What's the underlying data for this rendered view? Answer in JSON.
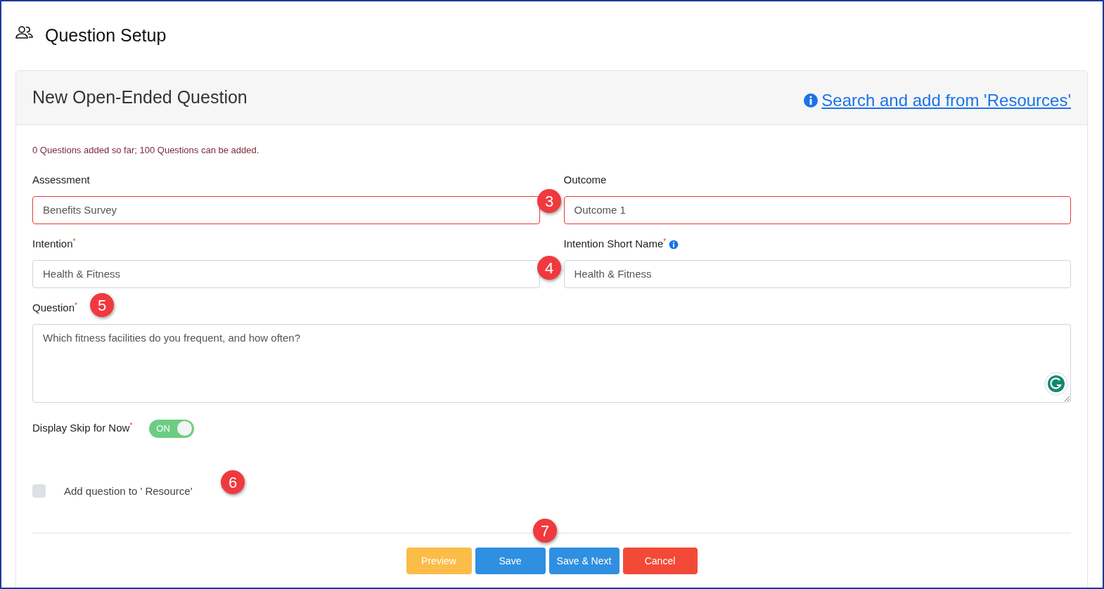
{
  "page": {
    "title": "Question Setup"
  },
  "card": {
    "title": "New Open-Ended Question",
    "resource_link": "Search and add from 'Resources'"
  },
  "count_note": "0 Questions added so far; 100 Questions can be added.",
  "fields": [
    {
      "kind": "input",
      "label": "Assessment",
      "value": "Benefits Survey",
      "error": true,
      "info": false
    },
    {
      "kind": "input",
      "label": "Outcome",
      "value": "Outcome 1",
      "error": true,
      "info": false
    },
    {
      "kind": "input",
      "label": "Intention",
      "required_mark": "*",
      "value": "Health & Fitness",
      "error": false,
      "info": false
    },
    {
      "kind": "input",
      "label": "Intention Short Name",
      "required_mark": "*",
      "value": "Health & Fitness",
      "error": false,
      "info": true
    },
    {
      "kind": "textarea",
      "label": "Question",
      "required_mark": "*",
      "value": "Which fitness facilities do you frequent, and how often?",
      "error": false,
      "info": false
    }
  ],
  "skip_toggle": {
    "label": "Display Skip for Now",
    "required_mark": "*",
    "on": true,
    "state_text": "ON"
  },
  "resource_checkbox": {
    "label": "Add question to ' Resource'",
    "checked": false
  },
  "buttons": [
    {
      "kind": "preview",
      "label": "Preview"
    },
    {
      "kind": "save",
      "label": "Save"
    },
    {
      "kind": "save",
      "label": "Save & Next"
    },
    {
      "kind": "cancel",
      "label": "Cancel"
    }
  ],
  "callouts": [
    "3",
    "4",
    "5",
    "6",
    "7"
  ]
}
